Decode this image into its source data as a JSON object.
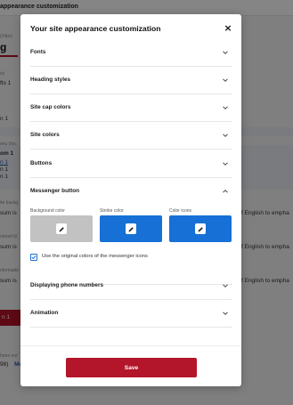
{
  "background": {
    "page_title": "appearance customization",
    "size_hint": "(24px)",
    "heading_fragment": "g",
    "label_k": "ck",
    "label_fts": "fts 1",
    "label_n1": "n 1",
    "menu_block": "enu bloc",
    "menu_item": "om 1",
    "links": [
      "n 1",
      "n 1",
      "n 1",
      "n 1"
    ],
    "site_bg": "ite backg",
    "lorem_1": "sum is",
    "colored_bl": "olored bl",
    "lorem_2": "sum is",
    "information": "nformatio",
    "lorem_3": "sum is",
    "english_1": "f English to empha",
    "english_2": "f English to empha",
    "english_3": "f English to empha",
    "red_button": "n 1",
    "phone_label": "hone nur",
    "phone_number": "98)",
    "phone_more": "Mo"
  },
  "modal": {
    "title": "Your site appearance customization",
    "close_icon": "×",
    "sections": [
      {
        "label": "Fonts",
        "expanded": false
      },
      {
        "label": "Heading styles",
        "expanded": false
      },
      {
        "label": "Site cap colors",
        "expanded": false
      },
      {
        "label": "Site colors",
        "expanded": false
      },
      {
        "label": "Buttons",
        "expanded": false
      },
      {
        "label": "Messenger button",
        "expanded": true
      },
      {
        "label": "Displaying phone numbers",
        "expanded": false
      },
      {
        "label": "Animation",
        "expanded": false
      }
    ],
    "messenger": {
      "background_label": "Background color",
      "stroke_label": "Stroke color",
      "icons_label": "Color icons",
      "background_color": "#c2c2c2",
      "stroke_color": "#1670d6",
      "icons_color": "#1670d6",
      "checkbox_label": "Use the original colors of the messenger icons",
      "checkbox_checked": true
    },
    "save_label": "Save"
  },
  "colors": {
    "accent": "#b3152a",
    "blue": "#1670d6",
    "overlay": "rgba(0,0,0,0.48)"
  }
}
